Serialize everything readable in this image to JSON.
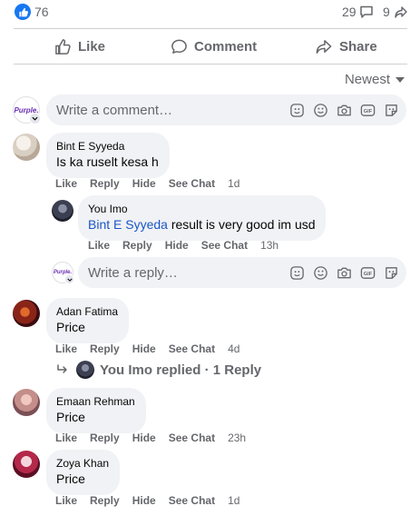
{
  "reactions": {
    "like_count": "76",
    "comment_count": "29",
    "share_count": "9"
  },
  "actions": {
    "like": "Like",
    "comment": "Comment",
    "share": "Share"
  },
  "sort": {
    "label": "Newest"
  },
  "composer": {
    "brand": "Purple.",
    "placeholder": "Write a comment…"
  },
  "reply_composer": {
    "brand": "Purple.",
    "placeholder": "Write a reply…"
  },
  "meta_labels": {
    "like": "Like",
    "reply": "Reply",
    "hide": "Hide",
    "see_chat": "See Chat"
  },
  "comments": [
    {
      "author": "Bint E Syyeda",
      "text": "Is ka ruselt kesa h",
      "time": "1d"
    },
    {
      "author": "Adan Fatima",
      "text": "Price",
      "time": "4d"
    },
    {
      "author": "Emaan Rehman",
      "text": "Price",
      "time": "23h"
    },
    {
      "author": "Zoya Khan",
      "text": "Price",
      "time": "1d"
    }
  ],
  "reply": {
    "author": "You Imo",
    "mention": "Bint E Syyeda",
    "text": " result is very good im usd",
    "time": "13h"
  },
  "replied_summary": {
    "text": "You Imo replied · 1 Reply"
  },
  "colors": {
    "accent": "#1877f2",
    "muted": "#65676b",
    "bubble": "#f0f2f5",
    "mention": "#1a56c7"
  }
}
